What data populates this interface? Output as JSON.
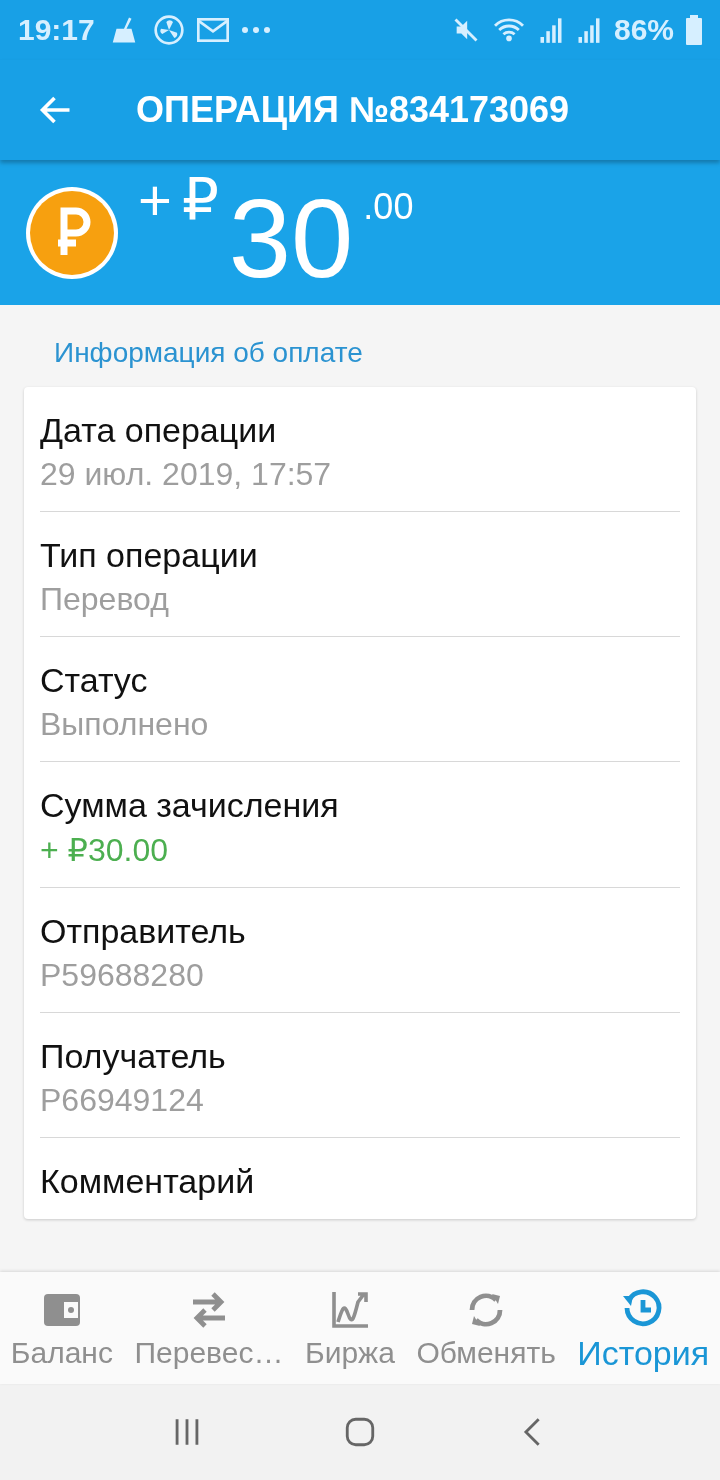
{
  "status_bar": {
    "time": "19:17",
    "battery": "86%"
  },
  "header": {
    "title": "ОПЕРАЦИЯ №834173069"
  },
  "amount": {
    "sign": "+",
    "currency": "₽",
    "whole": "30",
    "fraction": ".00"
  },
  "section_title": "Информация об оплате",
  "rows": [
    {
      "label": "Дата операции",
      "value": "29 июл. 2019, 17:57",
      "color": "#9e9e9e"
    },
    {
      "label": "Тип операции",
      "value": "Перевод",
      "color": "#9e9e9e"
    },
    {
      "label": "Статус",
      "value": "Выполнено",
      "color": "#9e9e9e"
    },
    {
      "label": "Сумма зачисления",
      "value": "+ ₽30.00",
      "color": "#4caf50"
    },
    {
      "label": "Отправитель",
      "value": "P59688280",
      "color": "#9e9e9e"
    },
    {
      "label": "Получатель",
      "value": "P66949124",
      "color": "#9e9e9e"
    },
    {
      "label": "Комментарий"
    }
  ],
  "bottom_nav": [
    {
      "kind": "wallet",
      "label": "Баланс",
      "selected": false
    },
    {
      "kind": "transfer",
      "label": "Перевес…",
      "selected": false
    },
    {
      "kind": "chart",
      "label": "Биржа",
      "selected": false
    },
    {
      "kind": "exchange",
      "label": "Обменять",
      "selected": false
    },
    {
      "kind": "history",
      "label": "История",
      "selected": true
    }
  ]
}
